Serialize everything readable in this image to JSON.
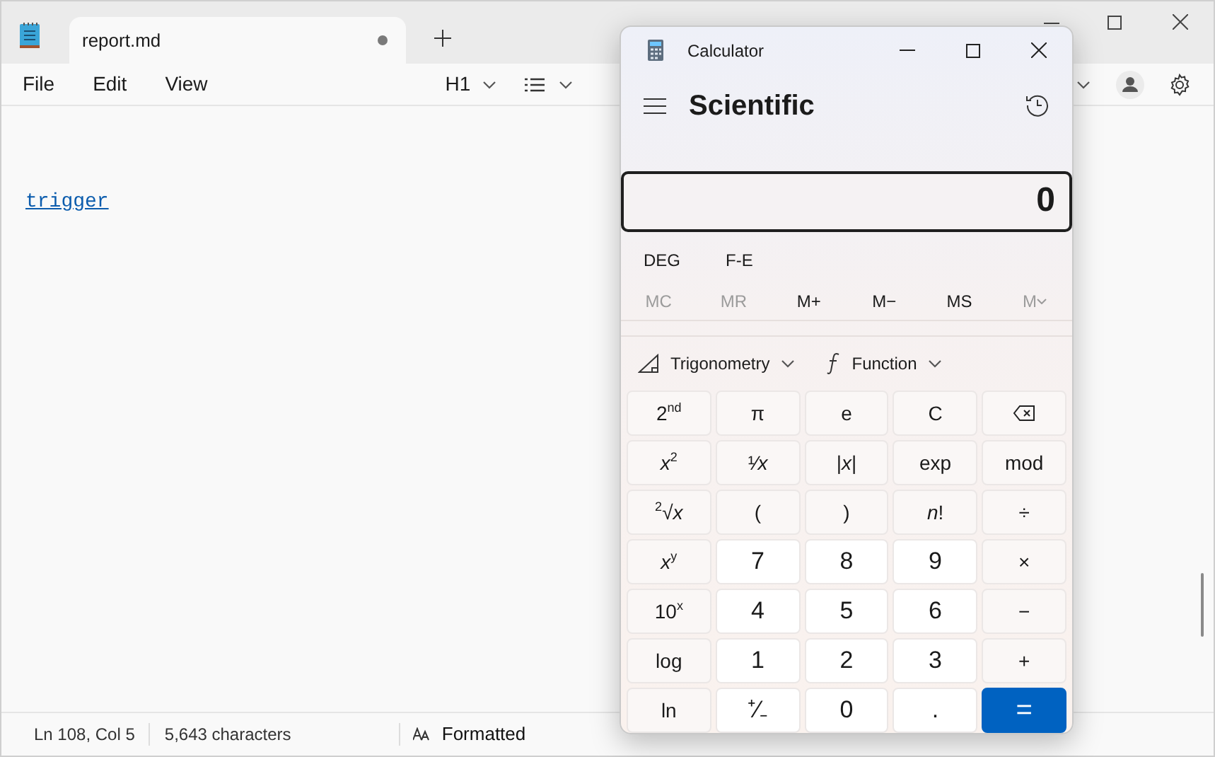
{
  "notepad": {
    "tab": {
      "title": "report.md",
      "unsaved": true,
      "selected": true
    },
    "menu": [
      "File",
      "Edit",
      "View"
    ],
    "toolbar": {
      "heading": "H1"
    },
    "document": {
      "link": "trigger"
    },
    "status_bar": {
      "position": "Ln 108, Col 5",
      "characters": "5,643 characters",
      "mode": "Formatted"
    }
  },
  "calculator": {
    "title": "Calculator",
    "mode": "Scientific",
    "display": "0",
    "angle_buttons": [
      "DEG",
      "F-E"
    ],
    "memory": [
      {
        "label": "MC",
        "disabled": true,
        "kind": "plain"
      },
      {
        "label": "MR",
        "disabled": true,
        "kind": "plain"
      },
      {
        "label": "M+",
        "disabled": false,
        "kind": "plain"
      },
      {
        "label": "M−",
        "disabled": false,
        "kind": "plain"
      },
      {
        "label": "MS",
        "disabled": false,
        "kind": "plain"
      },
      {
        "label": "M",
        "disabled": true,
        "kind": "menu"
      }
    ],
    "dropdowns": [
      {
        "label": "Trigonometry",
        "kind": "trig"
      },
      {
        "label": "Function",
        "kind": "function"
      }
    ],
    "keys": [
      {
        "label": "2$^{nd}$",
        "kind": "function"
      },
      {
        "label": "π",
        "kind": "function"
      },
      {
        "label": "e",
        "kind": "function"
      },
      {
        "label": "C",
        "kind": "function"
      },
      {
        "kind": "backspace"
      },
      {
        "label": "*x*$^{2}$",
        "kind": "function"
      },
      {
        "label": "¹⁄*x*",
        "kind": "function"
      },
      {
        "label": "|*x*|",
        "kind": "function"
      },
      {
        "label": "exp",
        "kind": "function"
      },
      {
        "label": "mod",
        "kind": "function"
      },
      {
        "label": "$^{2}$√*x*",
        "kind": "function"
      },
      {
        "label": "(",
        "kind": "function"
      },
      {
        "label": ")",
        "kind": "function"
      },
      {
        "label": "*n*!",
        "kind": "function"
      },
      {
        "label": "÷",
        "kind": "function"
      },
      {
        "label": "*x*$^{y}$",
        "kind": "function"
      },
      {
        "label": "7",
        "kind": "number"
      },
      {
        "label": "8",
        "kind": "number"
      },
      {
        "label": "9",
        "kind": "number"
      },
      {
        "label": "×",
        "kind": "function"
      },
      {
        "label": "10$^{x}$",
        "kind": "function"
      },
      {
        "label": "4",
        "kind": "number"
      },
      {
        "label": "5",
        "kind": "number"
      },
      {
        "label": "6",
        "kind": "number"
      },
      {
        "label": "−",
        "kind": "function"
      },
      {
        "label": "log",
        "kind": "function"
      },
      {
        "label": "1",
        "kind": "number"
      },
      {
        "label": "2",
        "kind": "number"
      },
      {
        "label": "3",
        "kind": "number"
      },
      {
        "label": "+",
        "kind": "function"
      },
      {
        "label": "ln",
        "kind": "function"
      },
      {
        "label": "⁺⁄₋",
        "kind": "number"
      },
      {
        "label": "0",
        "kind": "number"
      },
      {
        "label": ".",
        "kind": "number"
      },
      {
        "label": "=",
        "kind": "equals"
      }
    ]
  }
}
